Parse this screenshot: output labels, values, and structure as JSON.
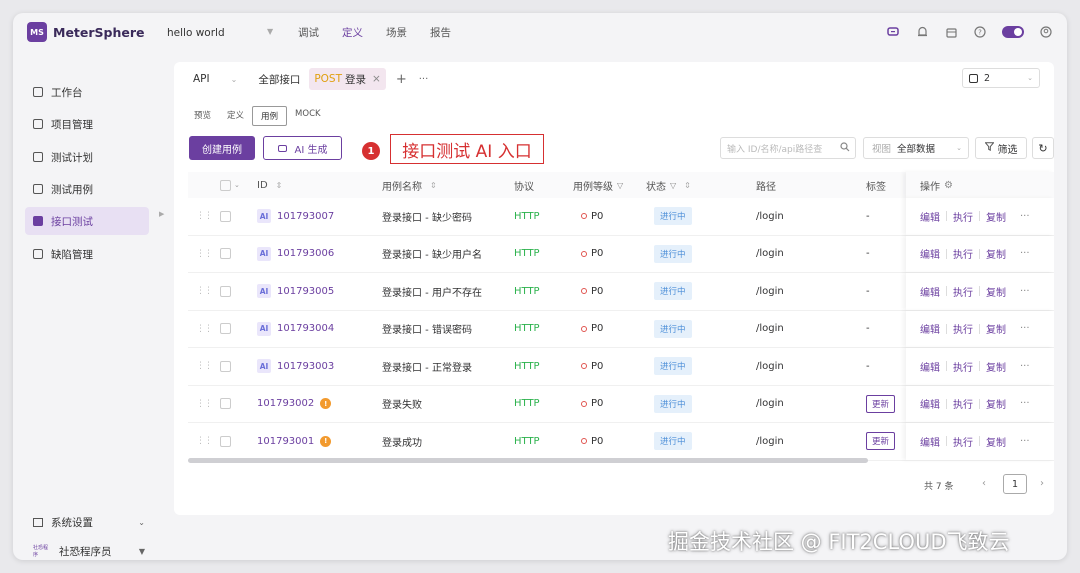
{
  "app": {
    "name": "MeterSphere",
    "logo_mark": "MS",
    "project": "hello world"
  },
  "topnav": [
    {
      "label": "调试",
      "active": false
    },
    {
      "label": "定义",
      "active": true
    },
    {
      "label": "场景",
      "active": false
    },
    {
      "label": "报告",
      "active": false
    }
  ],
  "header_icons": [
    "chat-icon",
    "bell-icon",
    "calendar-icon",
    "help-icon",
    "theme-toggle",
    "user-icon"
  ],
  "sidebar": {
    "items": [
      {
        "label": "工作台",
        "icon": "dashboard-icon",
        "active": false
      },
      {
        "label": "项目管理",
        "icon": "folder-icon",
        "active": false
      },
      {
        "label": "测试计划",
        "icon": "plan-icon",
        "active": false
      },
      {
        "label": "测试用例",
        "icon": "case-icon",
        "active": false
      },
      {
        "label": "接口测试",
        "icon": "api-icon",
        "active": true
      },
      {
        "label": "缺陷管理",
        "icon": "bug-icon",
        "active": false
      }
    ],
    "settings": "系统设置",
    "org_mark": "社恐程序",
    "org": "社恐程序员"
  },
  "tabs": {
    "protocol": "API",
    "all": "全部接口",
    "active_method": "POST",
    "active_name": "登录",
    "close": "×",
    "plus": "+",
    "more": "···"
  },
  "environment": {
    "value": "2"
  },
  "subtabs": [
    "预览",
    "定义",
    "用例",
    "MOCK"
  ],
  "subtab_active": "用例",
  "actions": {
    "create": "创建用例",
    "ai": "AI 生成",
    "search_placeholder": "输入 ID/名称/api路径查",
    "view_label": "视图",
    "view_value": "全部数据",
    "filter": "筛选"
  },
  "callout": {
    "number": "1",
    "text": "接口测试 AI 入口"
  },
  "table": {
    "headers": {
      "id": "ID",
      "name": "用例名称",
      "protocol": "协议",
      "level": "用例等级",
      "status": "状态",
      "path": "路径",
      "tags": "标签",
      "ops": "操作"
    },
    "rows": [
      {
        "ai": true,
        "id": "101793007",
        "name": "登录接口 - 缺少密码",
        "protocol": "HTTP",
        "level": "P0",
        "status": "进行中",
        "path": "/login",
        "tag": "-"
      },
      {
        "ai": true,
        "id": "101793006",
        "name": "登录接口 - 缺少用户名",
        "protocol": "HTTP",
        "level": "P0",
        "status": "进行中",
        "path": "/login",
        "tag": "-"
      },
      {
        "ai": true,
        "id": "101793005",
        "name": "登录接口 - 用户不存在",
        "protocol": "HTTP",
        "level": "P0",
        "status": "进行中",
        "path": "/login",
        "tag": "-"
      },
      {
        "ai": true,
        "id": "101793004",
        "name": "登录接口 - 错误密码",
        "protocol": "HTTP",
        "level": "P0",
        "status": "进行中",
        "path": "/login",
        "tag": "-"
      },
      {
        "ai": true,
        "id": "101793003",
        "name": "登录接口 - 正常登录",
        "protocol": "HTTP",
        "level": "P0",
        "status": "进行中",
        "path": "/login",
        "tag": "-"
      },
      {
        "ai": false,
        "warn": true,
        "id": "101793002",
        "name": "登录失败",
        "protocol": "HTTP",
        "level": "P0",
        "status": "进行中",
        "path": "/login",
        "tag_button": "更新"
      },
      {
        "ai": false,
        "warn": true,
        "id": "101793001",
        "name": "登录成功",
        "protocol": "HTTP",
        "level": "P0",
        "status": "进行中",
        "path": "/login",
        "tag_button": "更新"
      }
    ],
    "ops": [
      "编辑",
      "执行",
      "复制"
    ],
    "ops_more": "···"
  },
  "pagination": {
    "total": "共 7 条",
    "current": "1"
  },
  "watermark": "掘金技术社区 @ FIT2CLOUD飞致云",
  "colors": {
    "brand": "#6b3fa0",
    "http": "#2bb24c",
    "callout": "#d63031"
  }
}
